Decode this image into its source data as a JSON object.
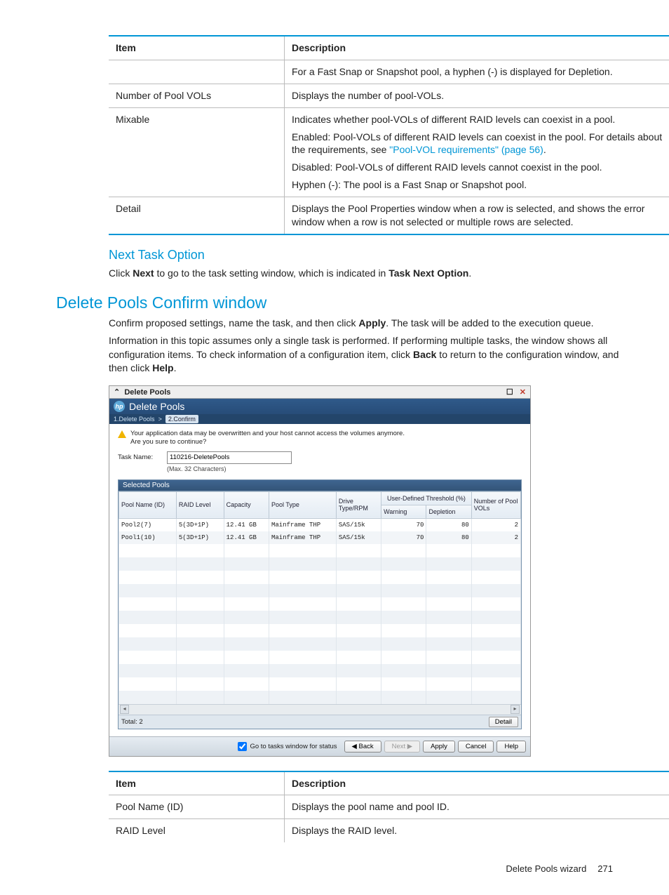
{
  "doctable1": {
    "headers": {
      "item": "Item",
      "desc": "Description"
    },
    "rows": [
      {
        "item": "",
        "desc": "For a Fast Snap or Snapshot pool, a hyphen (-) is displayed for Depletion."
      },
      {
        "item": "Number of Pool VOLs",
        "desc": "Displays the number of pool-VOLs."
      },
      {
        "item": "Mixable",
        "p1": "Indicates whether pool-VOLs of different RAID levels can coexist in a pool.",
        "p2_a": "Enabled: Pool-VOLs of different RAID levels can coexist in the pool. For details about the requirements, see ",
        "p2_link": "\"Pool-VOL requirements\" (page 56)",
        "p2_b": ".",
        "p3": "Disabled: Pool-VOLs of different RAID levels cannot coexist in the pool.",
        "p4": "Hyphen (-): The pool is a Fast Snap or Snapshot pool."
      },
      {
        "item": "Detail",
        "desc": "Displays the Pool Properties window when a row is selected, and shows the error window when a row is not selected or multiple rows are selected."
      }
    ]
  },
  "section_next": {
    "heading": "Next Task Option",
    "text_a": "Click ",
    "bold1": "Next",
    "text_b": " to go to the task setting window, which is indicated in ",
    "bold2": "Task Next Option",
    "text_c": "."
  },
  "section_main": {
    "heading": "Delete Pools Confirm window",
    "p1_a": "Confirm proposed settings, name the task, and then click ",
    "p1_bold": "Apply",
    "p1_b": ". The task will be added to the execution queue.",
    "p2_a": "Information in this topic assumes only a single task is performed. If performing multiple tasks, the window shows all configuration items. To check information of a configuration item, click ",
    "p2_bold1": "Back",
    "p2_b": " to return to the configuration window, and then click ",
    "p2_bold2": "Help",
    "p2_c": "."
  },
  "app": {
    "outer_title": "Delete Pools",
    "inner_title": "Delete Pools",
    "breadcrumb": {
      "step1": "1.Delete Pools",
      "sep": ">",
      "step2": "2.Confirm"
    },
    "warning": "Your application data may be overwritten and your host cannot access the volumes anymore.\nAre you sure to continue?",
    "task_label": "Task Name:",
    "task_value": "110216-DeletePools",
    "task_hint": "(Max. 32 Characters)",
    "selected_pools_title": "Selected Pools",
    "columns": {
      "pool_name": "Pool Name (ID)",
      "raid": "RAID Level",
      "capacity": "Capacity",
      "pool_type": "Pool Type",
      "drive": "Drive Type/RPM",
      "threshold_group": "User-Defined Threshold (%)",
      "warning": "Warning",
      "depletion": "Depletion",
      "num_vols": "Number of Pool VOLs"
    },
    "rows": [
      {
        "name": "Pool2(7)",
        "raid": "5(3D+1P)",
        "cap": "12.41 GB",
        "type": "Mainframe THP",
        "drive": "SAS/15k",
        "warn": "70",
        "depl": "80",
        "vols": "2"
      },
      {
        "name": "Pool1(10)",
        "raid": "5(3D+1P)",
        "cap": "12.41 GB",
        "type": "Mainframe THP",
        "drive": "SAS/15k",
        "warn": "70",
        "depl": "80",
        "vols": "2"
      }
    ],
    "total_label": "Total: 2",
    "detail_btn": "Detail",
    "goto_label": "Go to tasks window for status",
    "buttons": {
      "back": "◀ Back",
      "next": "Next ▶",
      "apply": "Apply",
      "cancel": "Cancel",
      "help": "Help"
    },
    "win_icons": {
      "max": "☐",
      "close": "✕",
      "collapse": "⌃"
    }
  },
  "doctable2": {
    "headers": {
      "item": "Item",
      "desc": "Description"
    },
    "rows": [
      {
        "item": "Pool Name (ID)",
        "desc": "Displays the pool name and pool ID."
      },
      {
        "item": "RAID Level",
        "desc": "Displays the RAID level."
      }
    ]
  },
  "footer": {
    "text": "Delete Pools wizard",
    "page": "271"
  }
}
